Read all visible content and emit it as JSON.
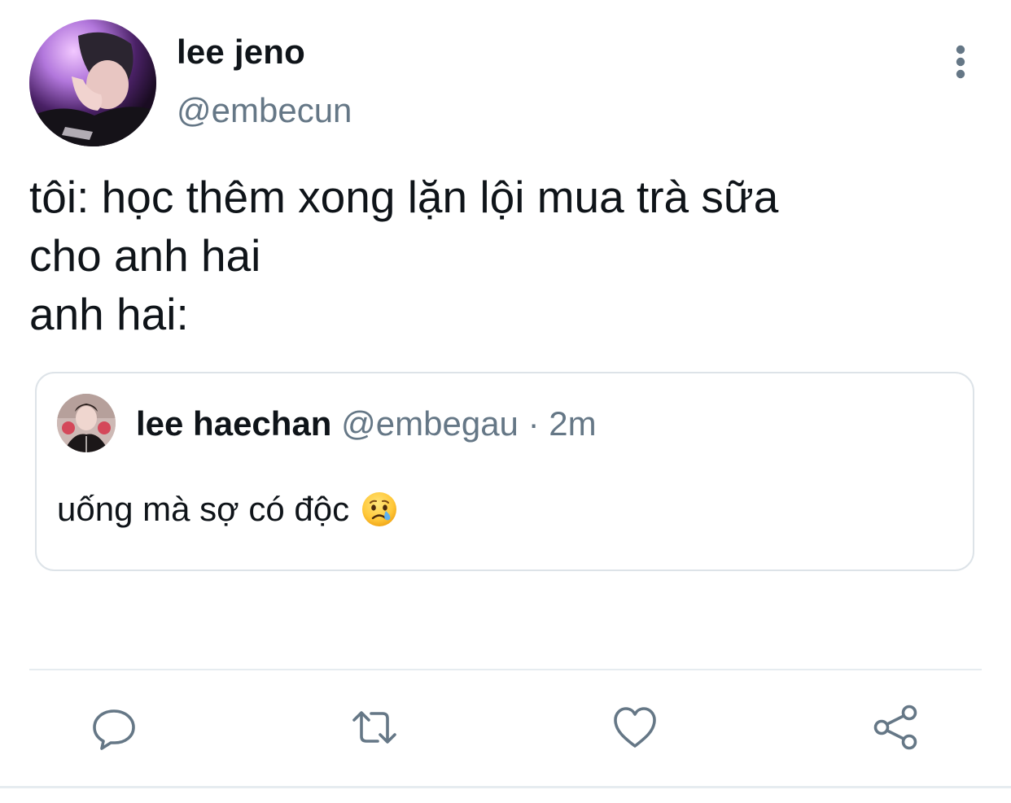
{
  "tweet": {
    "author": {
      "display_name": "lee jeno",
      "handle": "@embecun"
    },
    "text": "tôi: học thêm xong lặn lội mua trà sữa\ncho anh hai\nanh hai:",
    "quoted": {
      "author": {
        "display_name": "lee haechan",
        "handle": "@embegau"
      },
      "separator": "·",
      "time": "2m",
      "text": "uống mà sợ có độc"
    }
  },
  "icons": {
    "more": "more-vertical-icon",
    "reply": "reply-icon",
    "retweet": "retweet-icon",
    "like": "heart-icon",
    "share": "share-icon",
    "emoji": "crying-face-emoji"
  },
  "colors": {
    "text": "#0f1419",
    "secondary": "#657786",
    "border": "#dde3e8"
  }
}
